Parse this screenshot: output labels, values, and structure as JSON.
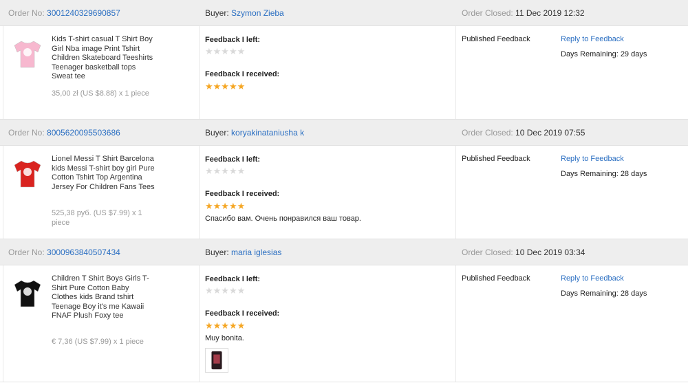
{
  "labels": {
    "order_no": "Order No:",
    "buyer": "Buyer:",
    "order_closed": "Order Closed:",
    "feedback_left": "Feedback I left:",
    "feedback_received": "Feedback I received:",
    "published": "Published Feedback",
    "reply": "Reply to Feedback"
  },
  "orders": [
    {
      "order_no": "3001240329690857",
      "buyer": "Szymon Zieba",
      "closed": "11 Dec 2019 12:32",
      "title": "Kids T-shirt casual T Shirt Boy Girl Nba image Print Tshirt Children Skateboard Teeshirts Teenager basketball tops Sweat tee",
      "price": "35,00 zł (US $8.88) x 1 piece",
      "left_rating": 0,
      "received_rating": 5,
      "received_text": "",
      "has_photo": false,
      "days_remaining": "Days Remaining: 29 days",
      "thumb_color": "#f7b8cf"
    },
    {
      "order_no": "8005620095503686",
      "buyer": "koryakinataniusha k",
      "closed": "10 Dec 2019 07:55",
      "title": "Lionel Messi T Shirt Barcelona kids Messi T-shirt boy girl Pure Cotton Tshirt Top Argentina Jersey For Children Fans Tees",
      "price": "525,38 руб. (US $7.99) x 1 piece",
      "left_rating": 0,
      "received_rating": 5,
      "received_text": "Спасибо вам. Очень понравился ваш товар.",
      "has_photo": false,
      "days_remaining": "Days Remaining: 28 days",
      "thumb_color": "#d9231f"
    },
    {
      "order_no": "3000963840507434",
      "buyer": "maria iglesias",
      "closed": "10 Dec 2019 03:34",
      "title": "Children T Shirt Boys Girls T-Shirt Pure Cotton Baby Clothes kids Brand tshirt Teenage Boy it's me Kawaii FNAF Plush Foxy tee",
      "price": "€ 7,36 (US $7.99) x 1 piece",
      "left_rating": 0,
      "received_rating": 5,
      "received_text": "Muy bonita.",
      "has_photo": true,
      "days_remaining": "Days Remaining: 28 days",
      "thumb_color": "#111111"
    }
  ]
}
